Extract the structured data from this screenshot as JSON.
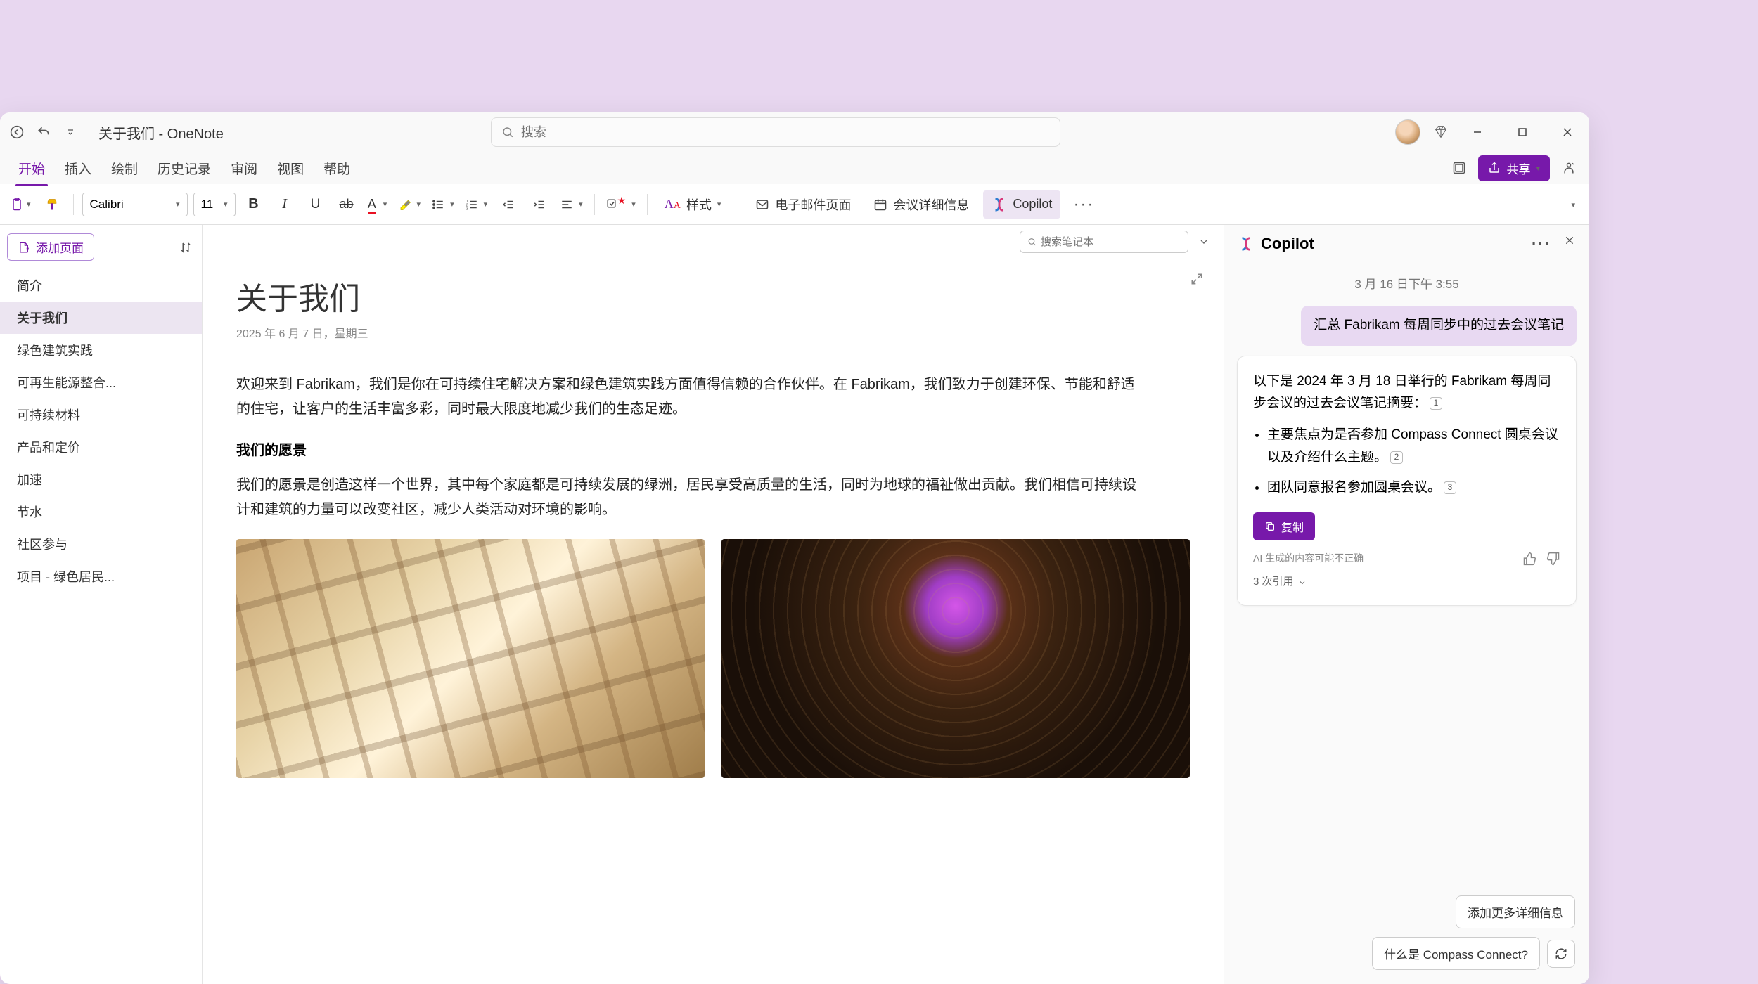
{
  "titlebar": {
    "title": "关于我们 - OneNote",
    "search_placeholder": "搜索"
  },
  "menu": {
    "items": [
      "开始",
      "插入",
      "绘制",
      "历史记录",
      "审阅",
      "视图",
      "帮助"
    ],
    "active_index": 0,
    "share_label": "共享"
  },
  "ribbon": {
    "font_name": "Calibri",
    "font_size": "11",
    "style_label": "样式",
    "email_label": "电子邮件页面",
    "meeting_label": "会议详细信息",
    "copilot_label": "Copilot"
  },
  "sidebar": {
    "add_page": "添加页面",
    "pages": [
      "简介",
      "关于我们",
      "绿色建筑实践",
      "可再生能源整合...",
      "可持续材料",
      "产品和定价",
      "加速",
      "节水",
      "社区参与",
      "项目 - 绿色居民..."
    ],
    "selected_index": 1
  },
  "notebook_search_placeholder": "搜索笔记本",
  "page": {
    "title": "关于我们",
    "date": "2025 年 6 月 7 日，星期三",
    "intro": "欢迎来到 Fabrikam，我们是你在可持续住宅解决方案和绿色建筑实践方面值得信赖的合作伙伴。在 Fabrikam，我们致力于创建环保、节能和舒适的住宅，让客户的生活丰富多彩，同时最大限度地减少我们的生态足迹。",
    "vision_heading": "我们的愿景",
    "vision_body": "我们的愿景是创造这样一个世界，其中每个家庭都是可持续发展的绿洲，居民享受高质量的生活，同时为地球的福祉做出贡献。我们相信可持续设计和建筑的力量可以改变社区，减少人类活动对环境的影响。"
  },
  "copilot": {
    "title": "Copilot",
    "timestamp": "3 月 16 日下午 3:55",
    "user_message": "汇总 Fabrikam 每周同步中的过去会议笔记",
    "ai_intro": "以下是 2024 年 3 月 18 日举行的 Fabrikam 每周同步会议的过去会议笔记摘要：",
    "ai_ref1": "1",
    "bullets": [
      {
        "text": "主要焦点为是否参加 Compass Connect 圆桌会议以及介绍什么主题。",
        "ref": "2"
      },
      {
        "text": "团队同意报名参加圆桌会议。",
        "ref": "3"
      }
    ],
    "copy_label": "复制",
    "disclaimer": "AI 生成的内容可能不正确",
    "citations": "3 次引用",
    "suggestion1": "添加更多详细信息",
    "suggestion2": "什么是 Compass Connect?"
  }
}
